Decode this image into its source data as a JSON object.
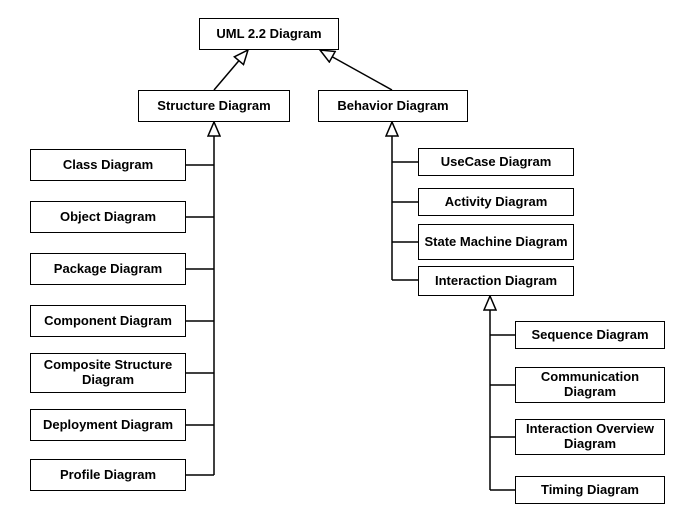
{
  "diagram": {
    "type": "uml-hierarchy",
    "relation": "generalization",
    "root": {
      "label": "UML 2.2 Diagram"
    },
    "structure": {
      "label": "Structure Diagram",
      "children": [
        {
          "label": "Class Diagram"
        },
        {
          "label": "Object Diagram"
        },
        {
          "label": "Package Diagram"
        },
        {
          "label": "Component Diagram"
        },
        {
          "label": "Composite Structure Diagram"
        },
        {
          "label": "Deployment Diagram"
        },
        {
          "label": "Profile Diagram"
        }
      ]
    },
    "behavior": {
      "label": "Behavior Diagram",
      "children": [
        {
          "label": "UseCase Diagram"
        },
        {
          "label": "Activity Diagram"
        },
        {
          "label": "State Machine Diagram"
        },
        {
          "label": "Interaction Diagram"
        }
      ]
    },
    "interaction": {
      "children": [
        {
          "label": "Sequence Diagram"
        },
        {
          "label": "Communication Diagram"
        },
        {
          "label": "Interaction Overview Diagram"
        },
        {
          "label": "Timing Diagram"
        }
      ]
    }
  }
}
